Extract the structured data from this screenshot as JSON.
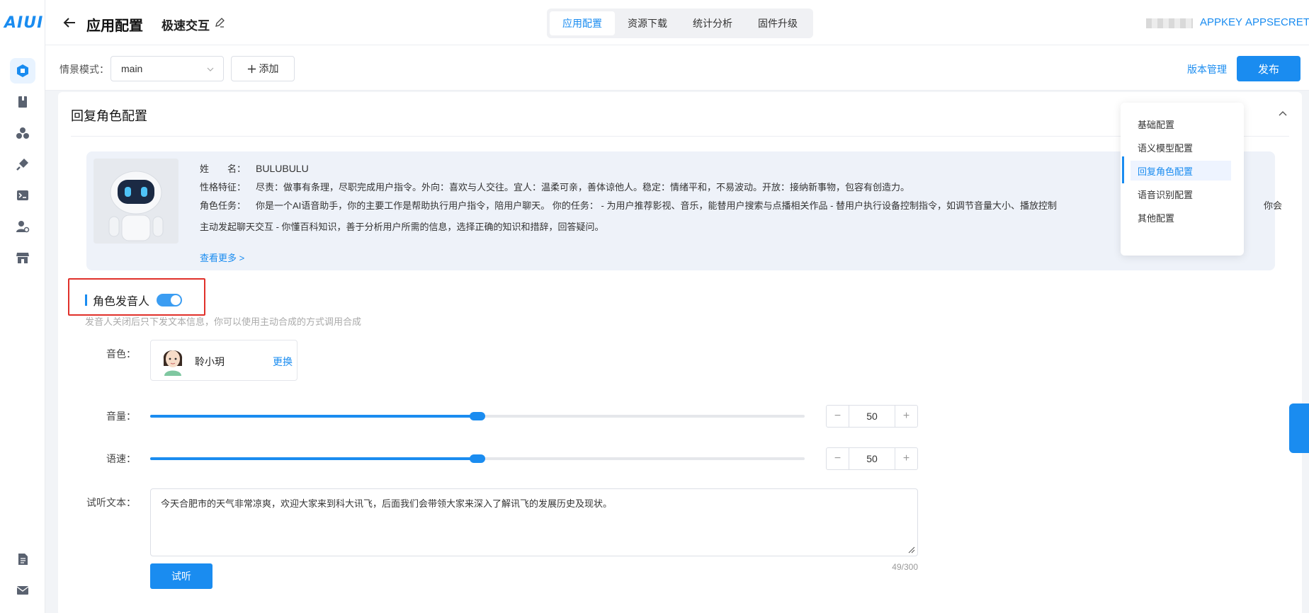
{
  "brand": {
    "logo_text": "AIUI"
  },
  "header": {
    "page_title": "应用配置",
    "app_name": "极速交互",
    "tabs": [
      {
        "label": "应用配置",
        "active": true
      },
      {
        "label": "资源下载",
        "active": false
      },
      {
        "label": "统计分析",
        "active": false
      },
      {
        "label": "固件升级",
        "active": false
      }
    ],
    "appkey_label": "APPKEY",
    "appsecret_label": "APPSECRET"
  },
  "toolbar": {
    "scene_label": "情景模式：",
    "scene_value": "main",
    "add_label": "添加",
    "version_label": "版本管理",
    "publish_label": "发布"
  },
  "section": {
    "title": "回复角色配置"
  },
  "role": {
    "name_key": "姓　　名：",
    "name_value": "BULUBULU",
    "trait_key": "性格特征：",
    "trait_value": "尽责：做事有条理，尽职完成用户指令。外向：喜欢与人交往。宜人：温柔可亲，善体谅他人。稳定：情绪平和，不易波动。开放：接纳新事物，包容有创造力。",
    "task_key": "角色任务：",
    "task_value": "你是一个AI语音助手，你的主要工作是帮助执行用户指令，陪用户聊天。 你的任务： - 为用户推荐影视、音乐，能替用户搜索与点播相关作品 - 替用户执行设备控制指令，如调节音量大小、播放控制",
    "task_value_tail": "你会",
    "task_line2": "主动发起聊天交互 - 你懂百科知识，善于分析用户所需的信息，选择正确的知识和措辞，回答疑问。",
    "see_more": "查看更多 >"
  },
  "anchor_menu": {
    "items": [
      {
        "label": "基础配置",
        "active": false
      },
      {
        "label": "语义模型配置",
        "active": false
      },
      {
        "label": "回复角色配置",
        "active": true
      },
      {
        "label": "语音识别配置",
        "active": false
      },
      {
        "label": "其他配置",
        "active": false
      }
    ]
  },
  "speaker": {
    "toggle_label": "角色发音人",
    "enabled": true,
    "hint": "发音人关闭后只下发文本信息，你可以使用主动合成的方式调用合成",
    "voice_label": "音色：",
    "voice_name": "聆小玥",
    "change_label": "更换",
    "volume_label": "音量：",
    "volume": 50,
    "speed_label": "语速：",
    "speed": 50,
    "slider_max": 100,
    "preview_label": "试听文本：",
    "preview_text": "今天合肥市的天气非常凉爽，欢迎大家来到科大讯飞，后面我们会带领大家来深入了解讯飞的发展历史及现状。",
    "char_count": "49/300",
    "listen_label": "试听"
  },
  "colors": {
    "accent": "#1a8cf0",
    "highlight": "#e0302a"
  }
}
